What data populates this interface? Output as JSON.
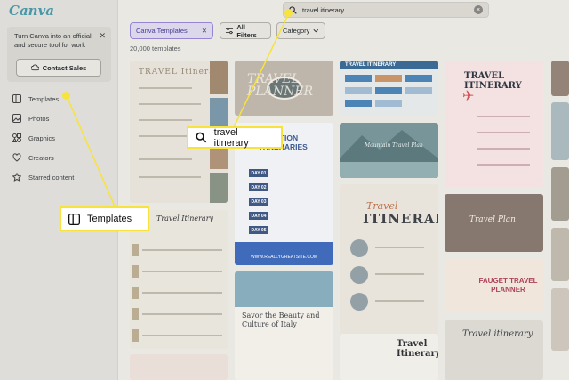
{
  "app": {
    "logo": "Canva"
  },
  "promo": {
    "text": "Turn Canva into an official and secure tool for work",
    "close": "✕",
    "button": "Contact Sales"
  },
  "nav": {
    "items": [
      {
        "label": "Templates",
        "icon": "templates-icon"
      },
      {
        "label": "Photos",
        "icon": "photos-icon"
      },
      {
        "label": "Graphics",
        "icon": "graphics-icon"
      },
      {
        "label": "Creators",
        "icon": "creators-icon"
      },
      {
        "label": "Starred content",
        "icon": "star-icon"
      }
    ]
  },
  "search": {
    "value": "travel itinerary",
    "icon": "search-icon",
    "clear": "×"
  },
  "filters": {
    "chip": "Canva Templates",
    "chip_close": "✕",
    "all_filters": "All Filters",
    "category": "Category"
  },
  "results": {
    "count": "20,000 templates"
  },
  "cards": {
    "c1_title": "TRAVEL Itinerary",
    "c2_title": "TRAVEL PLANNER",
    "c3_title": "VACATION ITINERARIES",
    "c3_days": [
      "DAY 01",
      "DAY 02",
      "DAY 03",
      "DAY 04",
      "DAY 05"
    ],
    "c3_footer": "WWW.REALLYGREATSITE.COM",
    "c4_title": "TRAVEL ITINERARY",
    "c5_title": "Mountain Travel Plan",
    "c6_title1": "Travel",
    "c6_title2": "ITINERARY",
    "c7_title": "TRAVEL ITINERARY",
    "c8_title": "Travel Plan",
    "c9_title": "FAUGET TRAVEL PLANNER",
    "c10_title": "Travel itinerary",
    "c11_title": "Travel Itinerary",
    "c12_title": "Savor the Beauty and Culture of Italy",
    "c13_title": "Travel Itinerary"
  },
  "callouts": {
    "search": "travel itinerary",
    "templates": "Templates"
  },
  "colors": {
    "accent": "#8f7ad0",
    "callout": "#f7e33c"
  }
}
